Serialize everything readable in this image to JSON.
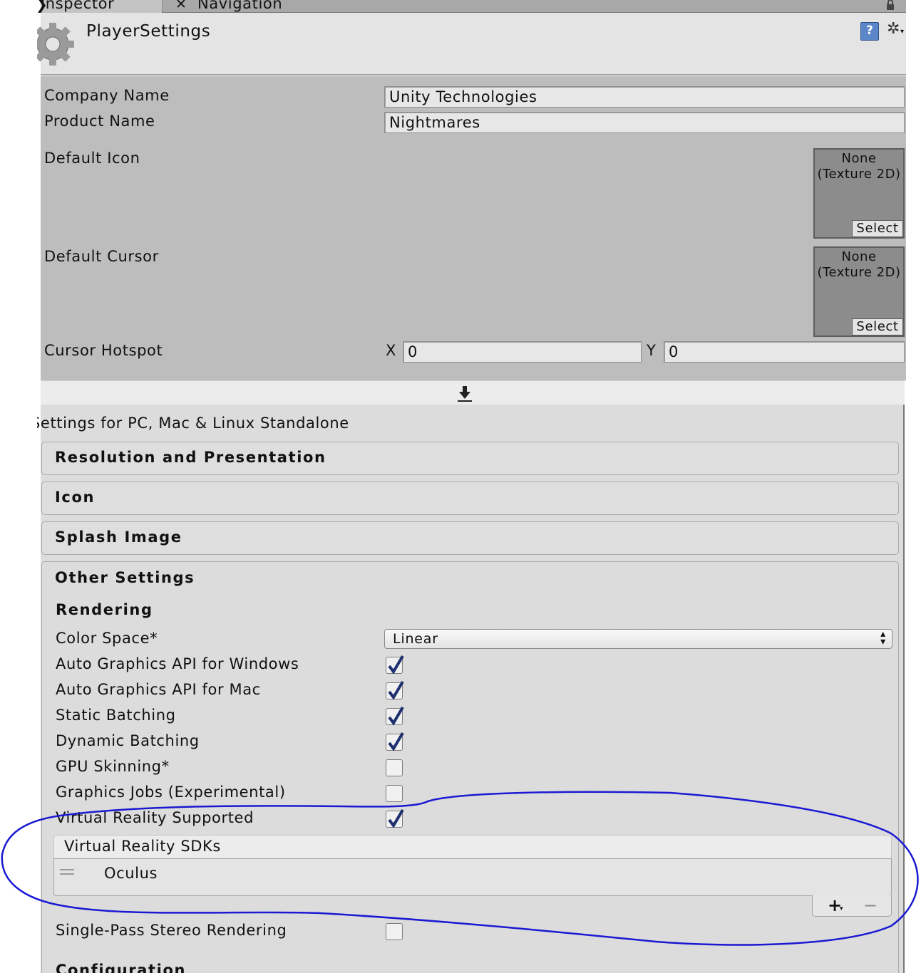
{
  "tabs": [
    {
      "label": "Inspector"
    },
    {
      "label": "Navigation"
    }
  ],
  "header": {
    "title": "PlayerSettings"
  },
  "fields": {
    "company_name": {
      "label": "Company Name",
      "value": "Unity Technologies"
    },
    "product_name": {
      "label": "Product Name",
      "value": "Nightmares"
    },
    "default_icon": {
      "label": "Default Icon",
      "value": "None (Texture 2D)",
      "select": "Select"
    },
    "default_cursor": {
      "label": "Default Cursor",
      "value": "None (Texture 2D)",
      "select": "Select"
    },
    "cursor_hotspot": {
      "label": "Cursor Hotspot",
      "x_label": "X",
      "x_value": "0",
      "y_label": "Y",
      "y_value": "0"
    }
  },
  "platform": {
    "title": "Settings for PC, Mac & Linux Standalone"
  },
  "sections": [
    {
      "label": "Resolution and Presentation"
    },
    {
      "label": "Icon"
    },
    {
      "label": "Splash Image"
    },
    {
      "label": "Other Settings"
    }
  ],
  "rendering": {
    "heading": "Rendering",
    "color_space": {
      "label": "Color Space*",
      "value": "Linear"
    },
    "options": [
      {
        "label": "Auto Graphics API for Windows",
        "checked": true
      },
      {
        "label": "Auto Graphics API for Mac",
        "checked": true
      },
      {
        "label": "Static Batching",
        "checked": true
      },
      {
        "label": "Dynamic Batching",
        "checked": true
      },
      {
        "label": "GPU Skinning*",
        "checked": false
      },
      {
        "label": "Graphics Jobs (Experimental)",
        "checked": false
      },
      {
        "label": "Virtual Reality Supported",
        "checked": true
      }
    ],
    "vr_sdks": {
      "title": "Virtual Reality SDKs",
      "items": [
        {
          "label": "Oculus"
        }
      ],
      "add_symbol": "+",
      "remove_symbol": "−"
    },
    "single_pass": {
      "label": "Single-Pass Stereo Rendering",
      "checked": false
    }
  },
  "next_heading": "Configuration",
  "colors": {
    "annotation": "#1a1ad2",
    "checkmark": "#1c2f6e",
    "panel": "#dcdcdc",
    "upper_panel": "#bdbdbd"
  }
}
